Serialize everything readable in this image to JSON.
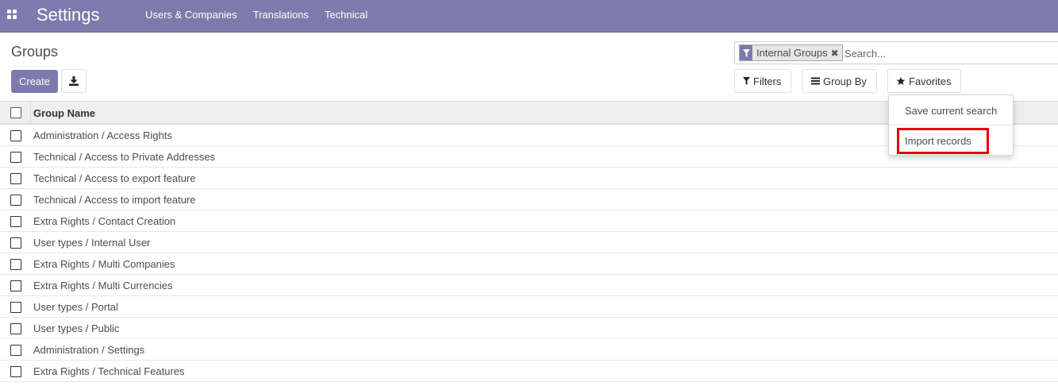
{
  "navbar": {
    "app_title": "Settings",
    "menu": [
      "Users & Companies",
      "Translations",
      "Technical"
    ],
    "bg_color": "#7c7bad"
  },
  "control_panel": {
    "breadcrumb": "Groups",
    "create_label": "Create",
    "download_icon": "download-icon"
  },
  "search": {
    "facet_label": "Internal Groups",
    "facet_icon": "filter-icon",
    "placeholder": "Search...",
    "filters_label": "Filters",
    "groupby_label": "Group By",
    "favorites_label": "Favorites"
  },
  "favorites_dropdown": {
    "items": [
      "Save current search",
      "Import records"
    ],
    "highlighted_item": "Import records",
    "highlight_color": "#e2000f"
  },
  "table": {
    "column_header": "Group Name",
    "rows": [
      "Administration / Access Rights",
      "Technical / Access to Private Addresses",
      "Technical / Access to export feature",
      "Technical / Access to import feature",
      "Extra Rights / Contact Creation",
      "User types / Internal User",
      "Extra Rights / Multi Companies",
      "Extra Rights / Multi Currencies",
      "User types / Portal",
      "User types / Public",
      "Administration / Settings",
      "Extra Rights / Technical Features"
    ]
  }
}
